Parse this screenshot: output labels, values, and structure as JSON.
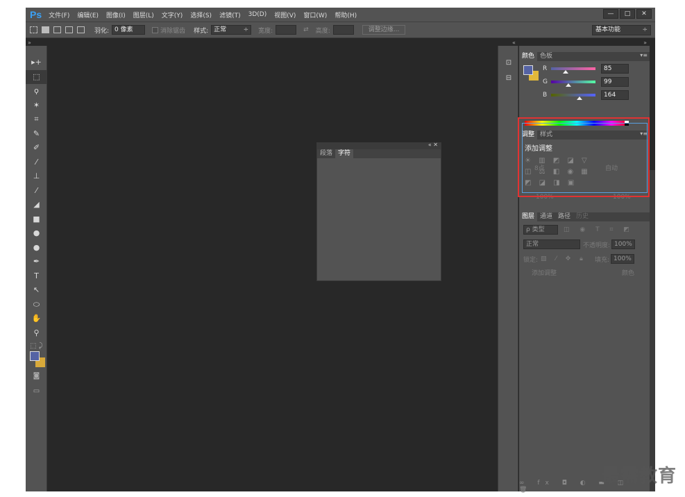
{
  "app": {
    "logo": "Ps",
    "menu": [
      "文件(F)",
      "编辑(E)",
      "图像(I)",
      "图层(L)",
      "文字(Y)",
      "选择(S)",
      "滤镜(T)",
      "3D(D)",
      "视图(V)",
      "窗口(W)",
      "帮助(H)"
    ],
    "window_controls": [
      "—",
      "□",
      "✕"
    ]
  },
  "options": {
    "feather_label": "羽化:",
    "feather_value": "0 像素",
    "antialias_label": "消除锯齿",
    "style_label": "样式:",
    "style_value": "正常",
    "width_label": "宽度:",
    "height_label": "高度:",
    "refine_edge": "调整边缘...",
    "workspace": "基本功能"
  },
  "float_panel": {
    "tabs": [
      "段落",
      "字符"
    ],
    "active_tab": "字符",
    "controls": "«  ✕"
  },
  "color_panel": {
    "tabs": [
      "颜色",
      "色板"
    ],
    "channels": [
      {
        "label": "R",
        "value": "85",
        "fraction": 0.333
      },
      {
        "label": "G",
        "value": "99",
        "fraction": 0.388
      },
      {
        "label": "B",
        "value": "164",
        "fraction": 0.643
      }
    ],
    "fg_color": "#5563a4",
    "bg_color": "#e2b83a"
  },
  "adjust_panel": {
    "tabs": [
      "调整",
      "样式"
    ],
    "title": "添加调整",
    "ghost_auto": "自动",
    "ghost_point": "8点",
    "ghost_pct1": "100%",
    "ghost_pct2": "100%"
  },
  "layers_panel": {
    "tabs": [
      "图层",
      "通道",
      "路径"
    ],
    "ghost_tab": "历史",
    "kind_label": "ρ 类型",
    "blend": "正常",
    "opacity_label": "不透明度:",
    "opacity_value": "100%",
    "lock_label": "锁定:",
    "fill_label": "填充:",
    "fill_value": "100%",
    "ghost_history": "添加调整",
    "ghost_row": "颜色"
  },
  "watermark": "最需教育"
}
